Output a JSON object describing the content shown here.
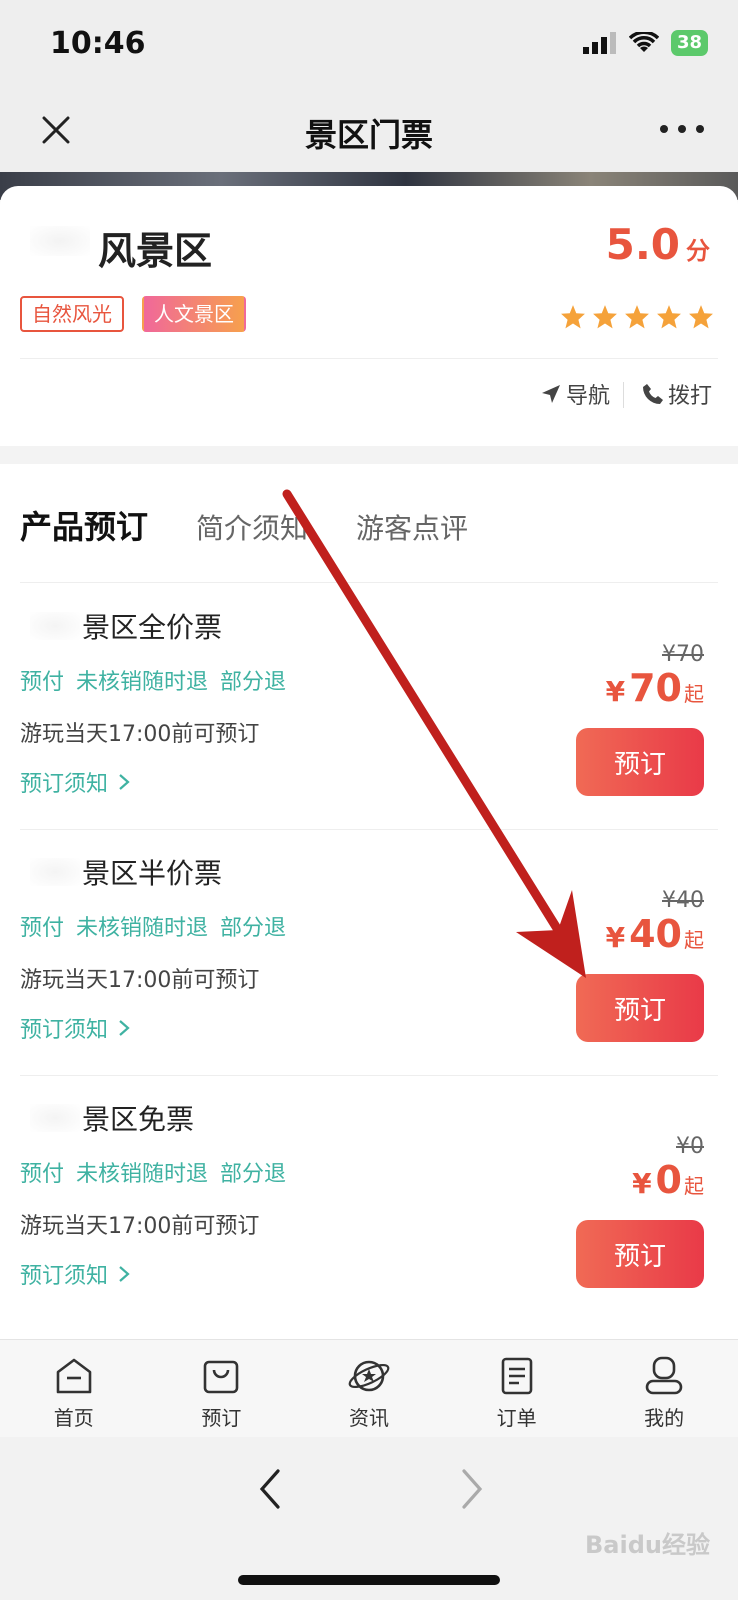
{
  "status_bar": {
    "time": "10:46",
    "battery": "38"
  },
  "nav": {
    "title": "景区门票",
    "close_icon": "close-icon",
    "more_icon": "more-icon"
  },
  "scenic": {
    "name": "风景区",
    "rating": "5.0",
    "rating_unit": "分",
    "tags": [
      "自然风光",
      "人文景区"
    ],
    "stars": 5,
    "actions": {
      "navigate": "导航",
      "call": "拨打"
    }
  },
  "tabs": [
    {
      "label": "产品预订",
      "active": true
    },
    {
      "label": "简介须知",
      "active": false
    },
    {
      "label": "游客点评",
      "active": false
    }
  ],
  "tickets": [
    {
      "name": "景区全价票",
      "tags": [
        "预付",
        "未核销随时退",
        "部分退"
      ],
      "time": "游玩当天17:00前可预订",
      "notice": "预订须知",
      "old_price": "¥70",
      "currency": "¥",
      "price": "70",
      "suffix": "起",
      "button": "预订"
    },
    {
      "name": "景区半价票",
      "tags": [
        "预付",
        "未核销随时退",
        "部分退"
      ],
      "time": "游玩当天17:00前可预订",
      "notice": "预订须知",
      "old_price": "¥40",
      "currency": "¥",
      "price": "40",
      "suffix": "起",
      "button": "预订"
    },
    {
      "name": "景区免票",
      "tags": [
        "预付",
        "未核销随时退",
        "部分退"
      ],
      "time": "游玩当天17:00前可预订",
      "notice": "预订须知",
      "old_price": "¥0",
      "currency": "¥",
      "price": "0",
      "suffix": "起",
      "button": "预订"
    }
  ],
  "bottom_nav": [
    {
      "label": "首页",
      "icon": "home-icon"
    },
    {
      "label": "预订",
      "icon": "bag-icon"
    },
    {
      "label": "资讯",
      "icon": "planet-icon"
    },
    {
      "label": "订单",
      "icon": "document-icon"
    },
    {
      "label": "我的",
      "icon": "user-icon"
    }
  ],
  "watermark": "Baidu经验",
  "colors": {
    "accent": "#e8553e",
    "teal": "#3fb2a2",
    "arrow": "#c0201d"
  }
}
